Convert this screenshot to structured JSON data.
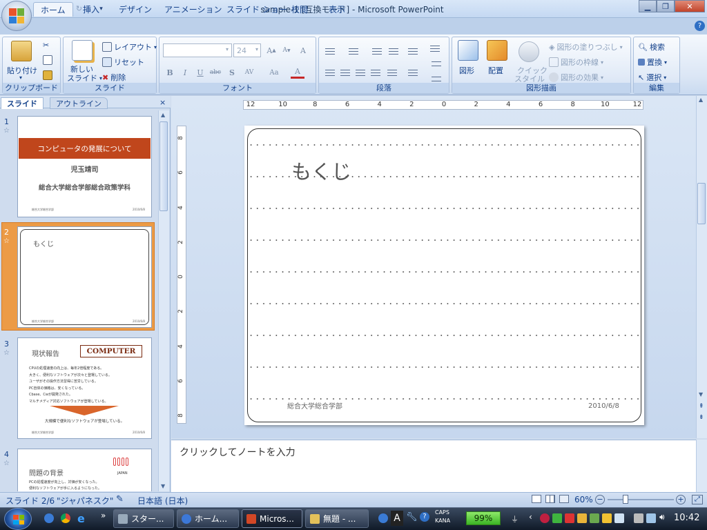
{
  "window": {
    "title": "sample-1 [互換モード] - Microsoft PowerPoint"
  },
  "ribbon": {
    "tabs": [
      "ホーム",
      "挿入",
      "デザイン",
      "アニメーション",
      "スライド ショー",
      "校閲",
      "表示"
    ],
    "clipboard": {
      "paste": "貼り付け",
      "label": "クリップボード"
    },
    "slides": {
      "new_slide_1": "新しい",
      "new_slide_2": "スライド",
      "layout": "レイアウト",
      "reset": "リセット",
      "delete": "削除",
      "label": "スライド"
    },
    "font": {
      "size": "24",
      "label": "フォント",
      "bold": "B",
      "italic": "I",
      "underline": "U",
      "strike": "abc",
      "shadow": "S",
      "spacing": "AV",
      "case": "Aa",
      "color": "A"
    },
    "paragraph": {
      "label": "段落"
    },
    "drawing": {
      "shapes": "図形",
      "arrange": "配置",
      "quick_1": "クイック",
      "quick_2": "スタイル",
      "fill": "図形の塗りつぶし",
      "outline": "図形の枠線",
      "effects": "図形の効果",
      "label": "図形描画"
    },
    "editing": {
      "find": "検索",
      "replace": "置換",
      "select": "選択",
      "label": "編集"
    }
  },
  "pane": {
    "tab_slides": "スライド",
    "tab_outline": "アウトライン",
    "close": "×",
    "slides": [
      {
        "num": "1",
        "title": "コンピュータの発展について",
        "author": "児玉靖司",
        "org": "総合大学総合学部総合政策学科",
        "footer": "総合大学総合学部",
        "date": "2010/6/8"
      },
      {
        "num": "2",
        "title": "もくじ",
        "footer": "総合大学総合学部",
        "date": "2010/6/8"
      },
      {
        "num": "3",
        "title": "現状報告",
        "badge": "COMPUTER",
        "bullets": [
          "CPUの処理速度の向上は、毎年2倍程度である。",
          "大きく、便利なソフトウェアが次々と登場している。",
          "ユーザがその操作方法習得に苦労している。",
          "PC自体の価格は、安くなっている。",
          "Cbase、Cwが開発された。",
          "マルチメディア対応ソフトウェアが登場している。"
        ],
        "conclusion": "大規模で便利なソフトウェアが登場している。",
        "footer": "総合大学総合学部",
        "date": "2010/6/8"
      },
      {
        "num": "4",
        "title": "問題の背景",
        "logo": "JAPAN",
        "bullets": [
          "PCの処理速度が向上し、対価が安くなった。",
          "便利なソフトウェアが手に入るようになった。"
        ]
      }
    ]
  },
  "main_slide": {
    "title": "もくじ",
    "footer": "総合大学総合学部",
    "date": "2010/6/8"
  },
  "ruler": {
    "h_labels": [
      "12",
      "10",
      "8",
      "6",
      "4",
      "2",
      "0",
      "2",
      "4",
      "6",
      "8",
      "10",
      "12"
    ],
    "v_labels": [
      "8",
      "6",
      "4",
      "2",
      "0",
      "2",
      "4",
      "6",
      "8"
    ]
  },
  "notes": {
    "placeholder": "クリックしてノートを入力"
  },
  "status": {
    "slide": "スライド 2/6",
    "theme": "\"ジャパネスク\"",
    "lang": "日本語 (日本)",
    "zoom": "60%"
  },
  "taskbar": {
    "buttons": [
      "スター...",
      "ホーム...",
      "Micros...",
      "無題 - ..."
    ],
    "caps": "CAPS",
    "kana": "KANA",
    "battery": "99%",
    "clock": "10:42"
  },
  "colors": {
    "accent": "#c0461c",
    "selection": "#ec9b46",
    "ribbon": "#dbe6f5"
  }
}
